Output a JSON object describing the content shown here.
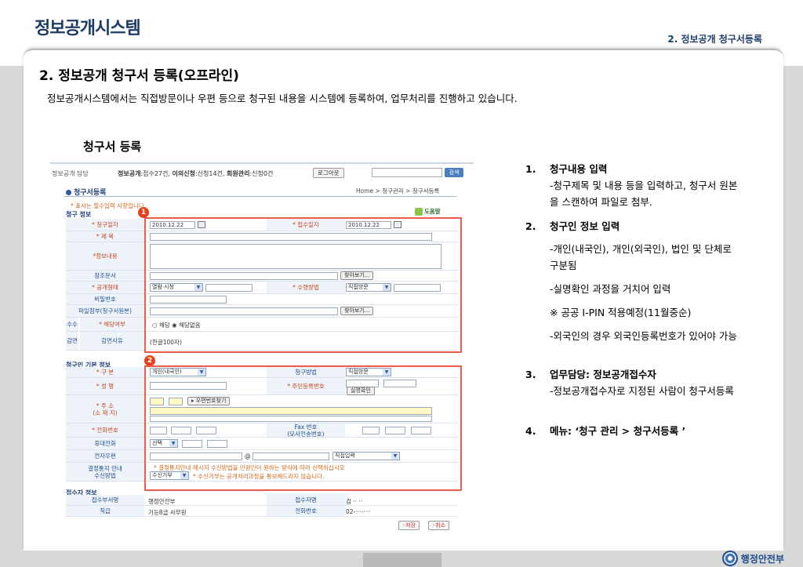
{
  "header": {
    "brand_title": "정보공개시스템",
    "section_label": "2. 정보공개 청구서등록",
    "footer_logo": "행정안전부"
  },
  "main": {
    "heading": "2. 정보공개 청구서 등록(오프라인)",
    "intro": "정보공개시스템에서는 직접방문이나 우편 등으로 청구된 내용을 시스템에 등록하여, 업무처리를 진행하고 있습니다.",
    "sub_heading": "청구서 등록"
  },
  "screenshot": {
    "user": "정보공개 담당",
    "stats": {
      "p1_label": "정보공개",
      "p1_value": ":접수27건,",
      "p2_label": "이의신청",
      "p2_value": ":신청14건,",
      "p3_label": "회원관리",
      "p3_value": ":신청0건"
    },
    "logout_label": "로그아웃",
    "search_button": "검색",
    "page_title": "청구서등록",
    "breadcrumb": "Home > 청구관리 > 청구서등록",
    "required_note": "* 표시는 필수입력 사항입니다.",
    "help_label": "도움말",
    "badge1": "1",
    "badge2": "2",
    "section_request": "청구 정보",
    "section_requester": "청구인 기본 정보",
    "section_receiver": "접수자 정보",
    "request": {
      "date_label": "* 청구일자",
      "date_value": "2010.12.22",
      "receipt_date_label": "* 접수일자",
      "receipt_date_value": "2010.12.22",
      "title_label": "* 제 목",
      "content_label": "*정보내용",
      "ref_doc_label": "참조문서",
      "browse_label": "찾아보기...",
      "disclosure_type_label": "* 공개형태",
      "disclosure_type_value": "열람·시청",
      "receive_method_label": "* 수령방법",
      "receive_method_value": "직접방문",
      "password_label": "비밀번호",
      "attachment_label": "파일첨부(청구서원본)",
      "browse_label2": "찾아보기...",
      "fee_side_label": "수수",
      "applicable_label": "* 해당여부",
      "applicable_opt1": "해당",
      "applicable_opt2": "해당없음",
      "reduce_side_label": "감면",
      "reduce_reason_label": "감면사유",
      "reduce_reason_value": "(한글100자)"
    },
    "requester": {
      "type_label": "* 구 분",
      "type_value": "개인(내국인)",
      "request_method_label": "청구방법",
      "request_method_value": "직접방문",
      "name_label": "* 성 명",
      "rrn_label": "* 주민등록번호",
      "verify_button": "실명확인",
      "address_label": "* 주 소\n(소 재 지)",
      "zipcode_button": "▸ 우편번호찾기",
      "phone_label": "* 전화번호",
      "fax_label": "Fax 번호\n(모사전송번호)",
      "mobile_label": "휴대전화",
      "mobile_select": "선택",
      "email_label": "전자우편",
      "email_at": "@",
      "email_select": "직접입력",
      "notice_label": "결정통지 안내\n수신방법",
      "notice_text1": "* 결정통지안내 메시지 수신방법을 민원인이 원하는 방식에 따라 선택하십시오",
      "notice_select": "수신거부",
      "notice_text2": "* 수신거부는 공개처리과정을 통보해드리지 않습니다."
    },
    "receiver": {
      "org_label": "접수부서명",
      "org_value": "행정안전부",
      "name_label": "접수자명",
      "name_value": "김 ·· ··",
      "grade_label": "직급",
      "grade_value": "기능8급 사무원",
      "phone_label": "전화번호",
      "phone_value": "02-···-····"
    },
    "save_button": "◦저장",
    "cancel_button": "◦취소"
  },
  "notes": [
    {
      "num": "1.",
      "head": "청구내용 입력",
      "lines": [
        "-청구제목 및 내용 등을 입력하고, 청구서 원본을 스캔하여 파일로 첨부."
      ]
    },
    {
      "num": "2.",
      "head": "청구인 정보 입력",
      "lines": [
        "-개인(내국인), 개인(외국인), 법인 및 단체로 구분됨",
        "-실명확인 과정을 거치어 입력",
        "※ 공공 I-PIN 적용예정(11월중순)",
        "-외국인의 경우 외국인등록번호가 있어야 가능"
      ]
    },
    {
      "num": "3.",
      "head": "업무담당: 정보공개접수자",
      "lines": [
        "-정보공개접수자로 지정된 사람이 청구서등록"
      ]
    },
    {
      "num": "4.",
      "head": "메뉴: ‘청구 관리 > 청구서등록 ’",
      "lines": []
    }
  ]
}
